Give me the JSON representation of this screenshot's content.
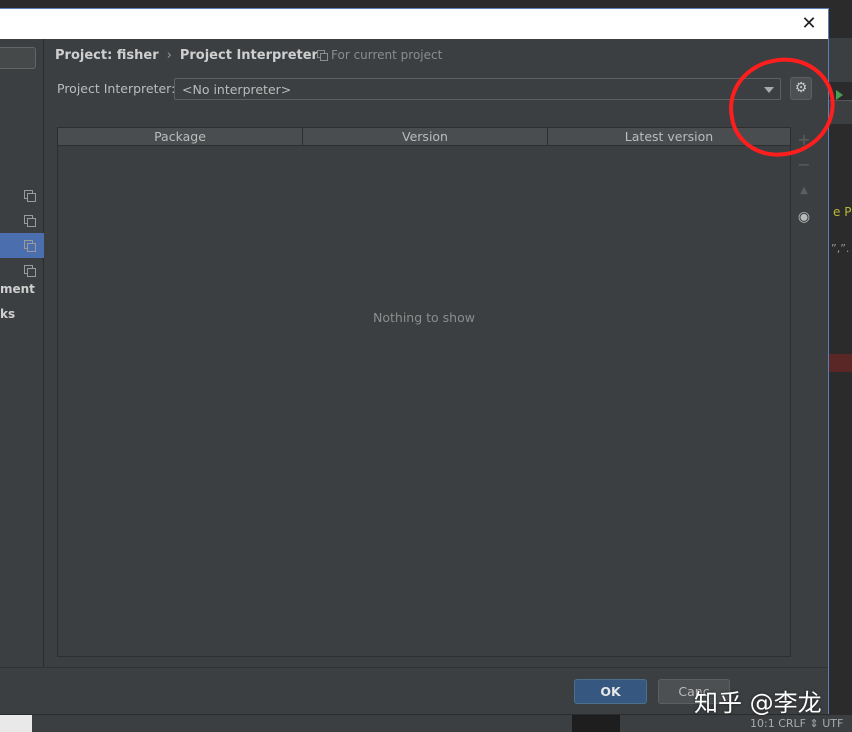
{
  "dialog": {
    "close_glyph": "✕"
  },
  "nav": {
    "items": [
      {
        "label": "",
        "selected": false
      },
      {
        "label": "",
        "selected": false
      },
      {
        "label": "",
        "selected": true
      },
      {
        "label": "",
        "selected": false
      }
    ],
    "text_items": [
      "ment",
      "ks"
    ]
  },
  "breadcrumb": {
    "project": "Project: fisher",
    "separator": "›",
    "page": "Project Interpreter",
    "scope": "For current project"
  },
  "interpreter": {
    "label": "Project Interpreter:",
    "value": "<No interpreter>",
    "settings_icon": "gear-icon"
  },
  "table": {
    "columns": [
      "Package",
      "Version",
      "Latest version"
    ],
    "empty_text": "Nothing to show"
  },
  "side_tools": {
    "add": "+",
    "remove": "−",
    "upgrade": "▲",
    "show_early": "◉"
  },
  "footer": {
    "ok": "OK",
    "cancel": "Canc"
  },
  "statusbar": {
    "text": "10:1   CRLF ⇕   UTF"
  },
  "background": {
    "tab_text": "e P",
    "code_text": "”,”."
  },
  "watermark": "知乎 @李龙",
  "colors": {
    "accent": "#4b6eaf",
    "ok_button": "#365880",
    "annotation": "#ff1e1e"
  }
}
